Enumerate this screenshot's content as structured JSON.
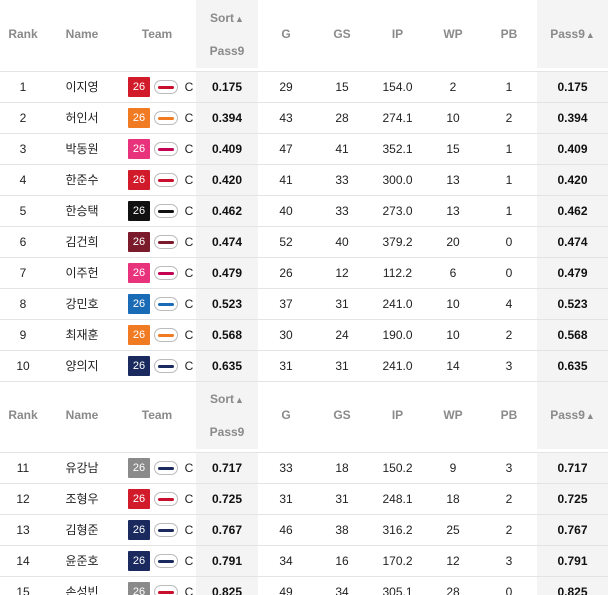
{
  "headers": {
    "rank": "Rank",
    "name": "Name",
    "team": "Team",
    "sort_top": "Sort",
    "sort_arrow": "▲",
    "sort_bottom": "Pass9",
    "g": "G",
    "gs": "GS",
    "ip": "IP",
    "wp": "WP",
    "pb": "PB",
    "pass9": "Pass9",
    "pass9_arrow": "▲"
  },
  "rows": [
    {
      "rank": "1",
      "name": "이지영",
      "num": "26",
      "num_color": "#d11a2a",
      "logo": "heroes-logo",
      "logo_color": "#c8102e",
      "pos": "C",
      "sort": "0.175",
      "g": "29",
      "gs": "15",
      "ip": "154.0",
      "wp": "2",
      "pb": "1",
      "pass9": "0.175"
    },
    {
      "rank": "2",
      "name": "허인서",
      "num": "26",
      "num_color": "#f07b22",
      "logo": "eagles-logo",
      "logo_color": "#f07b22",
      "pos": "C",
      "sort": "0.394",
      "g": "43",
      "gs": "28",
      "ip": "274.1",
      "wp": "10",
      "pb": "2",
      "pass9": "0.394"
    },
    {
      "rank": "3",
      "name": "박동원",
      "num": "26",
      "num_color": "#e8327c",
      "logo": "twins-logo",
      "logo_color": "#c30452",
      "pos": "C",
      "sort": "0.409",
      "g": "47",
      "gs": "41",
      "ip": "352.1",
      "wp": "15",
      "pb": "1",
      "pass9": "0.409"
    },
    {
      "rank": "4",
      "name": "한준수",
      "num": "26",
      "num_color": "#d11a2a",
      "logo": "tigers-logo",
      "logo_color": "#c8102e",
      "pos": "C",
      "sort": "0.420",
      "g": "41",
      "gs": "33",
      "ip": "300.0",
      "wp": "13",
      "pb": "1",
      "pass9": "0.420"
    },
    {
      "rank": "5",
      "name": "한승택",
      "num": "26",
      "num_color": "#111111",
      "logo": "tigers-logo",
      "logo_color": "#111111",
      "pos": "C",
      "sort": "0.462",
      "g": "40",
      "gs": "33",
      "ip": "273.0",
      "wp": "13",
      "pb": "1",
      "pass9": "0.462"
    },
    {
      "rank": "6",
      "name": "김건희",
      "num": "26",
      "num_color": "#7a1a2a",
      "logo": "heroes-logo",
      "logo_color": "#7a1a2a",
      "pos": "C",
      "sort": "0.474",
      "g": "52",
      "gs": "40",
      "ip": "379.2",
      "wp": "20",
      "pb": "0",
      "pass9": "0.474"
    },
    {
      "rank": "7",
      "name": "이주헌",
      "num": "26",
      "num_color": "#e8327c",
      "logo": "twins-logo",
      "logo_color": "#c30452",
      "pos": "C",
      "sort": "0.479",
      "g": "26",
      "gs": "12",
      "ip": "112.2",
      "wp": "6",
      "pb": "0",
      "pass9": "0.479"
    },
    {
      "rank": "8",
      "name": "강민호",
      "num": "26",
      "num_color": "#1a6bb5",
      "logo": "lions-logo",
      "logo_color": "#1a6bb5",
      "pos": "C",
      "sort": "0.523",
      "g": "37",
      "gs": "31",
      "ip": "241.0",
      "wp": "10",
      "pb": "4",
      "pass9": "0.523"
    },
    {
      "rank": "9",
      "name": "최재훈",
      "num": "26",
      "num_color": "#f07b22",
      "logo": "eagles-logo",
      "logo_color": "#f07b22",
      "pos": "C",
      "sort": "0.568",
      "g": "30",
      "gs": "24",
      "ip": "190.0",
      "wp": "10",
      "pb": "2",
      "pass9": "0.568"
    },
    {
      "rank": "10",
      "name": "양의지",
      "num": "26",
      "num_color": "#1a2a5e",
      "logo": "bears-logo",
      "logo_color": "#1a2a5e",
      "pos": "C",
      "sort": "0.635",
      "g": "31",
      "gs": "31",
      "ip": "241.0",
      "wp": "14",
      "pb": "3",
      "pass9": "0.635"
    },
    {
      "rank": "11",
      "name": "유강남",
      "num": "26",
      "num_color": "#8a8a8a",
      "logo": "giants-logo",
      "logo_color": "#1a2a5e",
      "pos": "C",
      "sort": "0.717",
      "g": "33",
      "gs": "18",
      "ip": "150.2",
      "wp": "9",
      "pb": "3",
      "pass9": "0.717"
    },
    {
      "rank": "12",
      "name": "조형우",
      "num": "26",
      "num_color": "#d11a2a",
      "logo": "landers-logo",
      "logo_color": "#c8102e",
      "pos": "C",
      "sort": "0.725",
      "g": "31",
      "gs": "31",
      "ip": "248.1",
      "wp": "18",
      "pb": "2",
      "pass9": "0.725"
    },
    {
      "rank": "13",
      "name": "김형준",
      "num": "26",
      "num_color": "#1a2a5e",
      "logo": "dinos-logo",
      "logo_color": "#1a2a5e",
      "pos": "C",
      "sort": "0.767",
      "g": "46",
      "gs": "38",
      "ip": "316.2",
      "wp": "25",
      "pb": "2",
      "pass9": "0.767"
    },
    {
      "rank": "14",
      "name": "윤준호",
      "num": "26",
      "num_color": "#1a2a5e",
      "logo": "bears-logo",
      "logo_color": "#1a2a5e",
      "pos": "C",
      "sort": "0.791",
      "g": "34",
      "gs": "16",
      "ip": "170.2",
      "wp": "12",
      "pb": "3",
      "pass9": "0.791"
    },
    {
      "rank": "15",
      "name": "손성빈",
      "num": "26",
      "num_color": "#8a8a8a",
      "logo": "giants-logo",
      "logo_color": "#c8102e",
      "pos": "C",
      "sort": "0.825",
      "g": "49",
      "gs": "34",
      "ip": "305.1",
      "wp": "28",
      "pb": "0",
      "pass9": "0.825"
    }
  ]
}
